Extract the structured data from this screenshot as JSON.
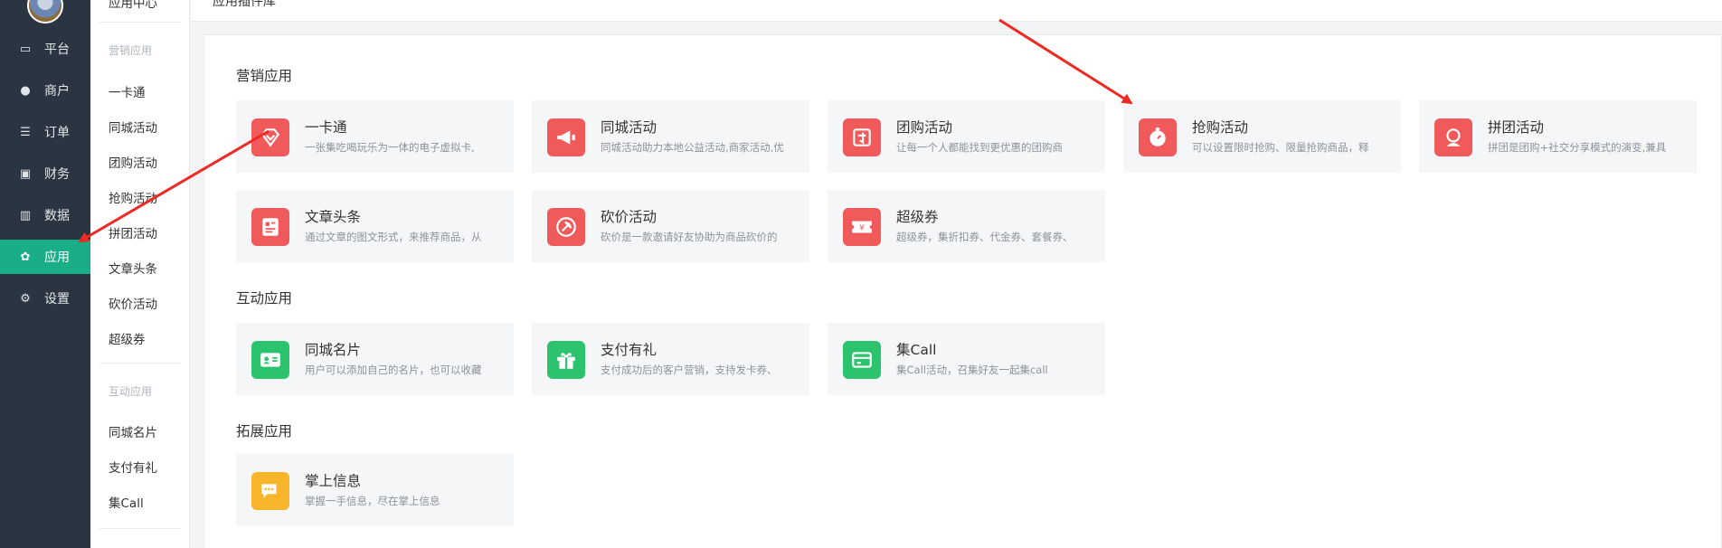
{
  "nav": {
    "items": [
      {
        "label": "平台",
        "icon": "monitor-icon",
        "glyph": "▭"
      },
      {
        "label": "商户",
        "icon": "users-icon",
        "glyph": "👥"
      },
      {
        "label": "订单",
        "icon": "list-icon",
        "glyph": "☰"
      },
      {
        "label": "财务",
        "icon": "money-icon",
        "glyph": "▣"
      },
      {
        "label": "数据",
        "icon": "bar-chart-icon",
        "glyph": "▥"
      },
      {
        "label": "应用",
        "icon": "apps-icon",
        "glyph": "✿",
        "active": true
      },
      {
        "label": "设置",
        "icon": "gear-icon",
        "glyph": "⚙"
      }
    ],
    "active_color": "#1aae88"
  },
  "subnav": {
    "top_item": "应用中心",
    "marketing_title": "营销应用",
    "marketing_items": [
      "一卡通",
      "同城活动",
      "团购活动",
      "抢购活动",
      "拼团活动",
      "文章头条",
      "砍价活动",
      "超级券"
    ],
    "interactive_title": "互动应用",
    "interactive_items": [
      "同城名片",
      "支付有礼",
      "集Call"
    ]
  },
  "breadcrumb": "应用插件库",
  "sections": {
    "marketing": {
      "title": "营销应用",
      "cards": [
        {
          "title": "一卡通",
          "desc": "一张集吃喝玩乐为一体的电子虚拟卡,",
          "color": "#f05a5a"
        },
        {
          "title": "同城活动",
          "desc": "同城活动助力本地公益活动,商家活动,优",
          "color": "#f05a5a"
        },
        {
          "title": "团购活动",
          "desc": "让每一个人都能找到更优惠的团购商",
          "color": "#f05a5a"
        },
        {
          "title": "抢购活动",
          "desc": "可以设置限时抢购、限量抢购商品，释",
          "color": "#f05a5a"
        },
        {
          "title": "拼团活动",
          "desc": "拼团是团购+社交分享模式的演变,兼具",
          "color": "#f05a5a"
        },
        {
          "title": "文章头条",
          "desc": "通过文章的图文形式，来推荐商品，从",
          "color": "#f05a5a"
        },
        {
          "title": "砍价活动",
          "desc": "砍价是一款邀请好友协助为商品砍价的",
          "color": "#f05a5a"
        },
        {
          "title": "超级券",
          "desc": "超级券，集折扣券、代金券、套餐券、",
          "color": "#f05a5a"
        }
      ]
    },
    "interactive": {
      "title": "互动应用",
      "cards": [
        {
          "title": "同城名片",
          "desc": "用户可以添加自己的名片，也可以收藏",
          "color": "#2bc36e"
        },
        {
          "title": "支付有礼",
          "desc": "支付成功后的客户营销，支持发卡券、",
          "color": "#2bc36e"
        },
        {
          "title": "集Call",
          "desc": "集Call活动，召集好友一起集call",
          "color": "#2bc36e"
        }
      ]
    },
    "extension": {
      "title": "拓展应用",
      "cards": [
        {
          "title": "掌上信息",
          "desc": "掌握一手信息，尽在掌上信息",
          "color": "#f7b52c"
        }
      ]
    }
  },
  "annotation_color": "#ee2a24"
}
